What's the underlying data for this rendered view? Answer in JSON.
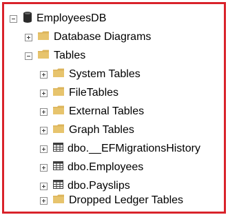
{
  "tree": {
    "root": {
      "label": "EmployeesDB",
      "icon": "database-icon",
      "expanded": true
    },
    "nodes": [
      {
        "label": "Database Diagrams",
        "icon": "folder-icon",
        "expanded": false
      },
      {
        "label": "Tables",
        "icon": "folder-icon",
        "expanded": true,
        "children": [
          {
            "label": "System Tables",
            "icon": "folder-icon",
            "expanded": false
          },
          {
            "label": "FileTables",
            "icon": "folder-icon",
            "expanded": false
          },
          {
            "label": "External Tables",
            "icon": "folder-icon",
            "expanded": false
          },
          {
            "label": "Graph Tables",
            "icon": "folder-icon",
            "expanded": false
          },
          {
            "label": "dbo.__EFMigrationsHistory",
            "icon": "table-icon",
            "expanded": false
          },
          {
            "label": "dbo.Employees",
            "icon": "table-icon",
            "expanded": false
          },
          {
            "label": "dbo.Payslips",
            "icon": "table-icon",
            "expanded": false
          },
          {
            "label": "Dropped Ledger Tables",
            "icon": "folder-icon",
            "expanded": false
          }
        ]
      }
    ]
  },
  "colors": {
    "frame_border": "#d9222a",
    "folder": "#dcb45a",
    "database": "#2b2b2b",
    "table_grid": "#3c3c3c"
  }
}
